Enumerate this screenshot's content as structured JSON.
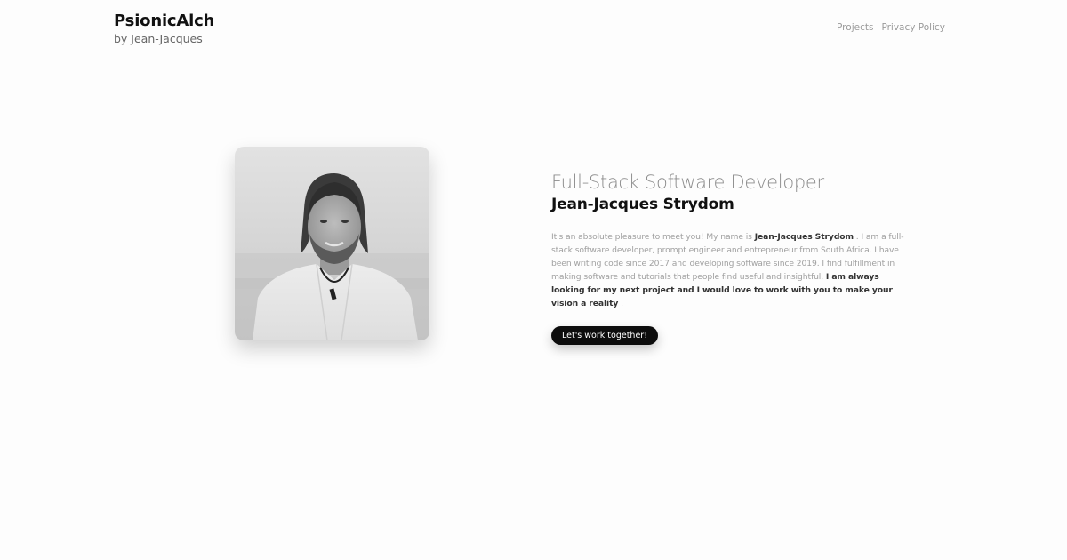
{
  "brand": {
    "title": "PsionicAlch",
    "subtitle": "by Jean-Jacques"
  },
  "nav": {
    "items": [
      {
        "label": "Projects"
      },
      {
        "label": "Privacy Policy"
      }
    ]
  },
  "profile": {
    "photo_icon": "portrait-photo",
    "role": "Full-Stack Software Developer",
    "name": "Jean-Jacques Strydom",
    "bio": {
      "part1": "It's an absolute pleasure to meet you! My name is ",
      "name_bold": "Jean-Jacques Strydom",
      "part2": " . I am a full-stack software developer, prompt engineer and entrepreneur from South Africa. I have been writing code since 2017 and developing software since 2019. I find fulfillment in making software and tutorials that people find useful and insightful. ",
      "cta_bold": "I am always looking for my next project and I would love to work with you to make your vision a reality",
      "part3": " ."
    },
    "cta_label": "Let's work together!"
  },
  "colors": {
    "background": "#fdfdfd",
    "button": "#0d0d0d",
    "muted_text": "#a0a0a0"
  }
}
